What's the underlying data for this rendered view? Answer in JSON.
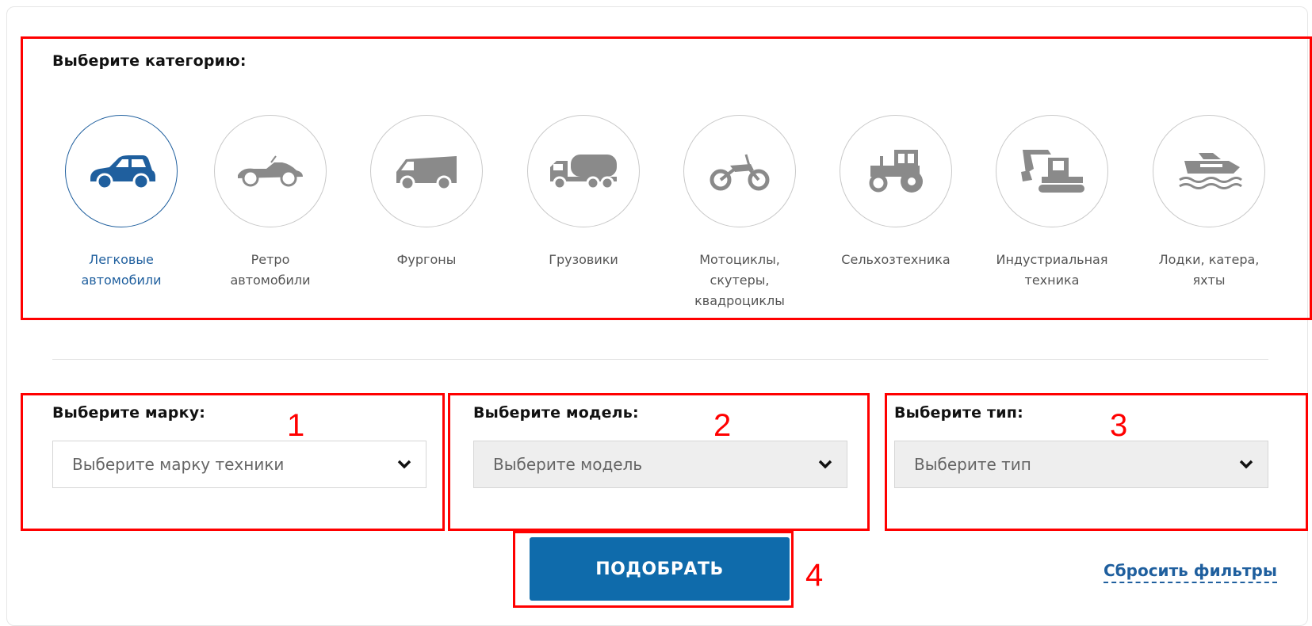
{
  "category_section": {
    "title": "Выберите категорию:",
    "items": [
      {
        "label_line1": "Легковые",
        "label_line2": "автомобили",
        "label_line3": "",
        "icon": "car-icon",
        "active": true
      },
      {
        "label_line1": "Ретро",
        "label_line2": "автомобили",
        "label_line3": "",
        "icon": "retro-car-icon",
        "active": false
      },
      {
        "label_line1": "Фургоны",
        "label_line2": "",
        "label_line3": "",
        "icon": "van-icon",
        "active": false
      },
      {
        "label_line1": "Грузовики",
        "label_line2": "",
        "label_line3": "",
        "icon": "truck-icon",
        "active": false
      },
      {
        "label_line1": "Мотоциклы,",
        "label_line2": "скутеры,",
        "label_line3": "квадроциклы",
        "icon": "motorcycle-icon",
        "active": false
      },
      {
        "label_line1": "Сельхозтехника",
        "label_line2": "",
        "label_line3": "",
        "icon": "tractor-icon",
        "active": false
      },
      {
        "label_line1": "Индустриальная",
        "label_line2": "техника",
        "label_line3": "",
        "icon": "excavator-icon",
        "active": false
      },
      {
        "label_line1": "Лодки, катера,",
        "label_line2": "яхты",
        "label_line3": "",
        "icon": "boat-icon",
        "active": false
      }
    ]
  },
  "filters": {
    "brand": {
      "title": "Выберите марку:",
      "placeholder": "Выберите марку техники",
      "marker": "1"
    },
    "model": {
      "title": "Выберите модель:",
      "placeholder": "Выберите модель",
      "marker": "2"
    },
    "type": {
      "title": "Выберите тип:",
      "placeholder": "Выберите тип",
      "marker": "3"
    }
  },
  "actions": {
    "submit_label": "ПОДОБРАТЬ",
    "submit_marker": "4",
    "reset_label": "Сбросить фильтры"
  },
  "colors": {
    "accent": "#1f5f9e",
    "button": "#0f6bab",
    "annotation": "#ff0000",
    "icon_gray": "#8a8a8a"
  }
}
